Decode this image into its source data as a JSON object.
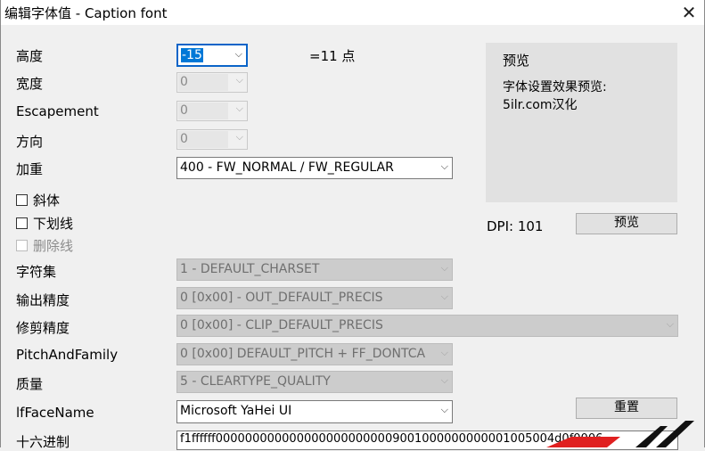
{
  "window": {
    "title": "编辑字体值 - Caption font",
    "close_glyph": "✕"
  },
  "fields": {
    "height": {
      "label": "高度",
      "value": "-15"
    },
    "width": {
      "label": "宽度",
      "value": "0"
    },
    "escapement": {
      "label": "Escapement",
      "value": "0"
    },
    "orientation": {
      "label": "方向",
      "value": "0"
    },
    "weight": {
      "label": "加重",
      "value": "400 - FW_NORMAL / FW_REGULAR"
    },
    "italic": {
      "label": "斜体"
    },
    "underline": {
      "label": "下划线"
    },
    "strikeout": {
      "label": "删除线"
    },
    "charset": {
      "label": "字符集",
      "value": "1 - DEFAULT_CHARSET"
    },
    "out_precision": {
      "label": "输出精度",
      "value": "0 [0x00] - OUT_DEFAULT_PRECIS"
    },
    "clip_precision": {
      "label": "修剪精度",
      "value": "0 [0x00] - CLIP_DEFAULT_PRECIS"
    },
    "pitch_family": {
      "label": "PitchAndFamily",
      "value": "0 [0x00] DEFAULT_PITCH + FF_DONTCA"
    },
    "quality": {
      "label": "质量",
      "value": "5 - CLEARTYPE_QUALITY"
    },
    "face_name": {
      "label": "lfFaceName",
      "value": "Microsoft YaHei UI"
    },
    "hex": {
      "label": "十六进制",
      "value": "f1ffffff0000000000000000000000009001000000000001005004d0f0006"
    }
  },
  "points_text": "=11 点",
  "preview": {
    "title": "预览",
    "line1": "字体设置效果预览:",
    "line2": "5ilr.com汉化"
  },
  "dpi_text": "DPI: 101",
  "buttons": {
    "preview": "预览",
    "reset": "重置"
  },
  "glyphs": {
    "arrow": "⌵"
  },
  "colors": {
    "focus": "#0078d7",
    "disabled_bg": "#cccccc",
    "watermark_red": "#e02020"
  }
}
